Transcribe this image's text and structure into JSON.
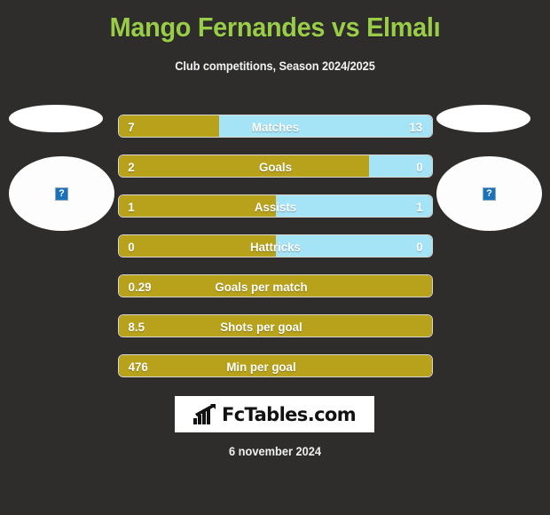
{
  "header": {
    "title": "Mango Fernandes vs Elmalı",
    "subtitle": "Club competitions, Season 2024/2025",
    "title_color": "#9acd47"
  },
  "avatars": {
    "home": {
      "placeholder_glyph": "?",
      "alt_name": "home-player-photo"
    },
    "away": {
      "placeholder_glyph": "?",
      "alt_name": "away-player-photo"
    }
  },
  "colors": {
    "background": "#2e2d2c",
    "home_bar": "#b9a21b",
    "away_bar": "#a5e3f7",
    "bar_border": "#d8d6ce",
    "text": "#ffffff"
  },
  "stats": [
    {
      "label": "Matches",
      "home": "7",
      "away": "13",
      "home_pct": 32,
      "split": true
    },
    {
      "label": "Goals",
      "home": "2",
      "away": "0",
      "home_pct": 80,
      "split": true
    },
    {
      "label": "Assists",
      "home": "1",
      "away": "1",
      "home_pct": 50,
      "split": true
    },
    {
      "label": "Hattricks",
      "home": "0",
      "away": "0",
      "home_pct": 50,
      "split": true
    },
    {
      "label": "Goals per match",
      "home": "0.29",
      "away": "",
      "home_pct": 100,
      "split": false
    },
    {
      "label": "Shots per goal",
      "home": "8.5",
      "away": "",
      "home_pct": 100,
      "split": false
    },
    {
      "label": "Min per goal",
      "home": "476",
      "away": "",
      "home_pct": 100,
      "split": false
    }
  ],
  "footer": {
    "logo_text": "FcTables.com",
    "logo_icon": "bar-chart-growth-icon",
    "date": "6 november 2024"
  }
}
